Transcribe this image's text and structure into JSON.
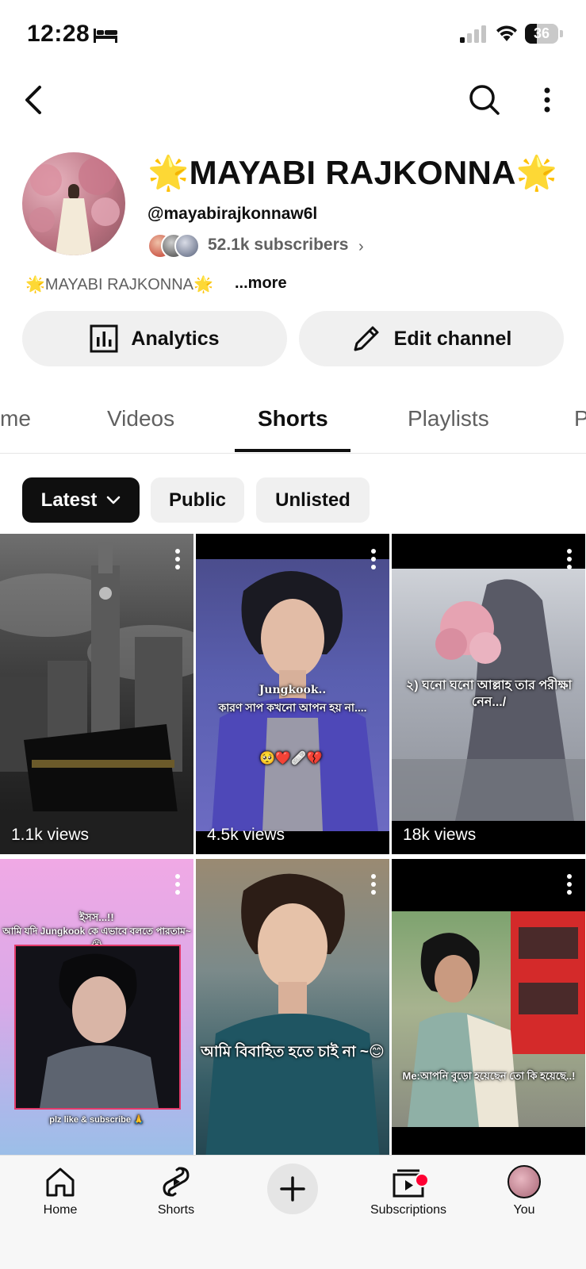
{
  "status_bar": {
    "time": "12:28",
    "battery": "36",
    "battery_level": 0.36
  },
  "channel": {
    "name": "🌟MAYABI RAJKONNA🌟",
    "handle": "@mayabirajkonnaw6l",
    "subscribers": "52.1k subscribers",
    "description": "🌟MAYABI RAJKONNA🌟",
    "more_label": "...more"
  },
  "actions": {
    "analytics_label": "Analytics",
    "edit_label": "Edit channel"
  },
  "tabs": [
    {
      "label": "me"
    },
    {
      "label": "Videos"
    },
    {
      "label": "Shorts",
      "active": true
    },
    {
      "label": "Playlists"
    },
    {
      "label": "P"
    }
  ],
  "filters": {
    "latest": "Latest",
    "public": "Public",
    "unlisted": "Unlisted"
  },
  "shorts": [
    {
      "views": "1.1k views"
    },
    {
      "views": "4.5k views",
      "caption_top": "Jungkook..",
      "caption": "কারণ সাপ কখনো আপন হয় না....",
      "emoji": "🥺❤️🩹💔"
    },
    {
      "views": "18k views",
      "caption": "২) ঘনো ঘনো আল্লাহ তার পরীক্ষা নেন.../"
    },
    {
      "views": "",
      "caption_top": "ইসস...!!",
      "caption": "আমি যদি Jungkook কে এভাবে বলতে পারতাম~😭",
      "caption_bottom": "plz like & subscribe 🙏"
    },
    {
      "views": "",
      "caption": "আমি বিবাহিত হতে চাই না ~😊"
    },
    {
      "views": "",
      "caption": "Me:আপনি বুড়ো হয়েছেন তো কি হয়েছে..!"
    }
  ],
  "nav": {
    "home": "Home",
    "shorts": "Shorts",
    "subscriptions": "Subscriptions",
    "you": "You"
  }
}
